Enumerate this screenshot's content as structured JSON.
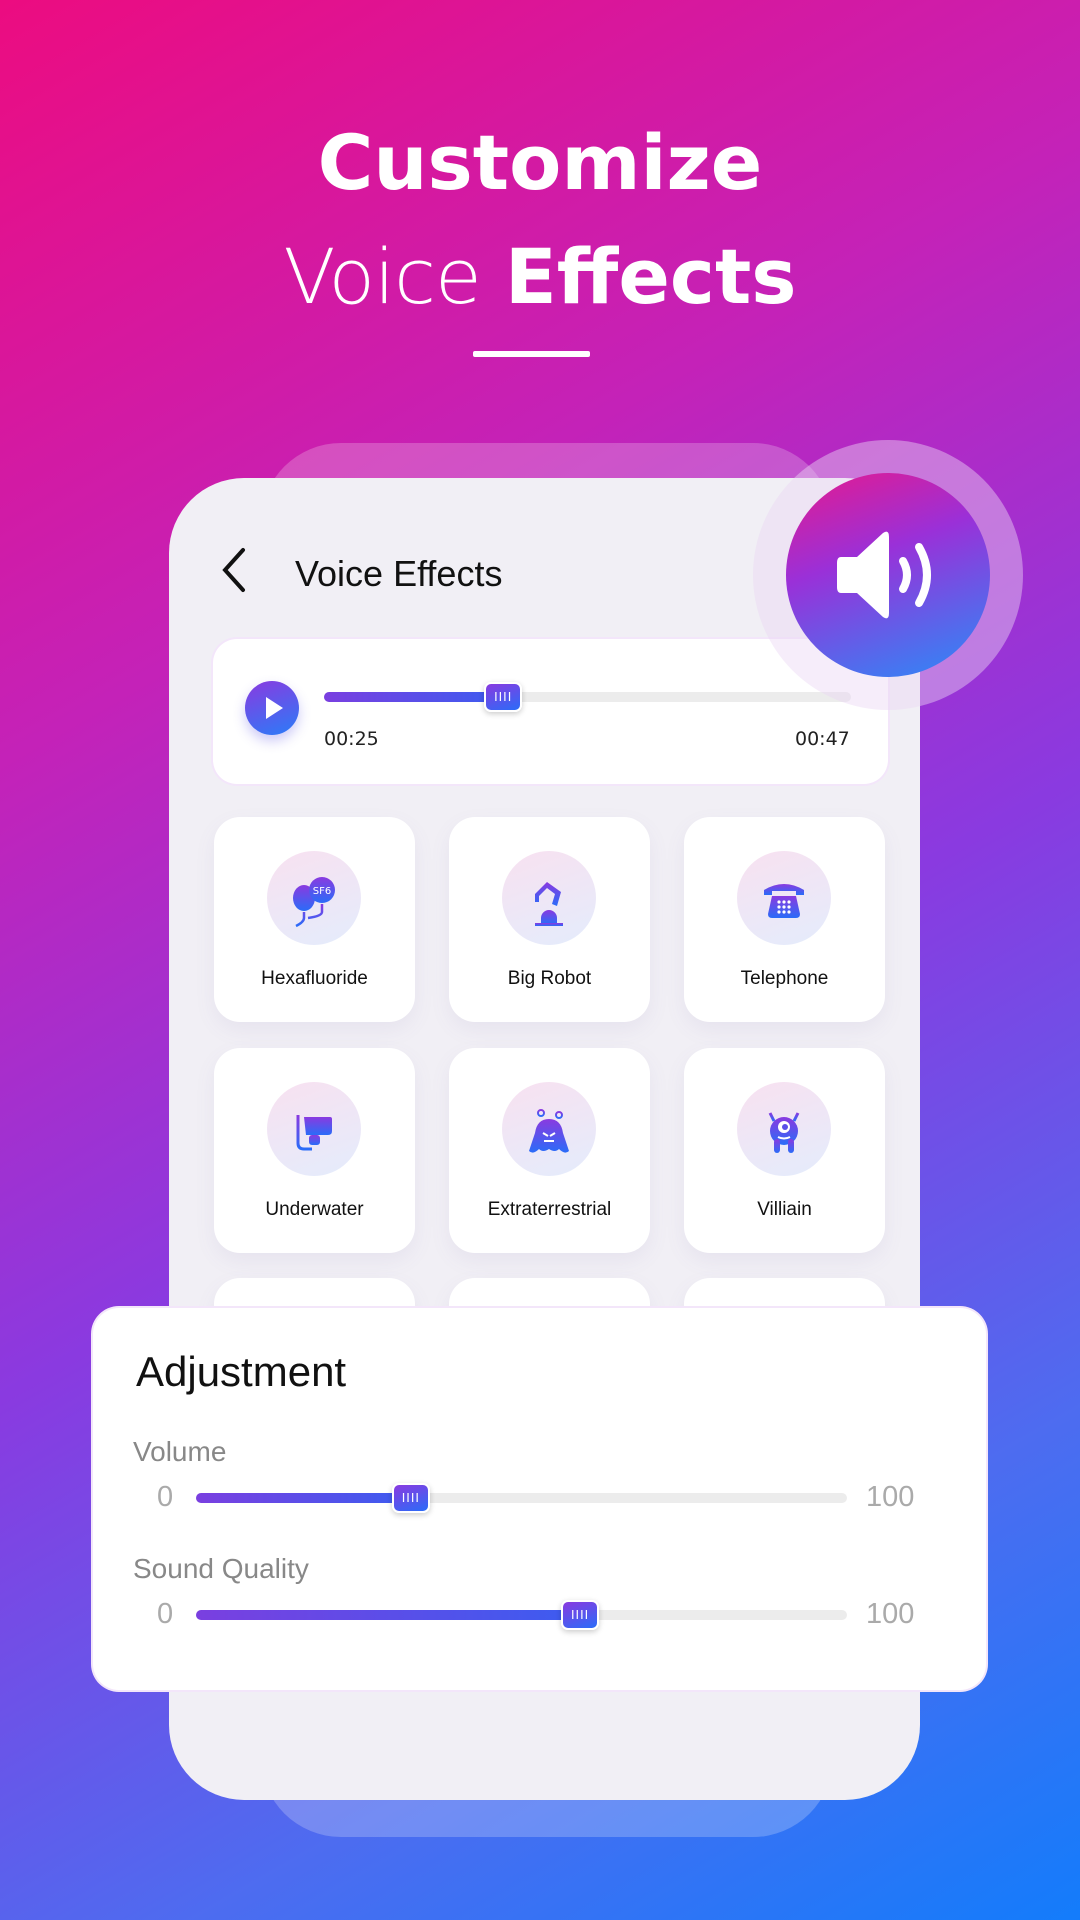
{
  "hero": {
    "line1": "Customize",
    "line2_light": "Voice",
    "line2_bold": "Effects"
  },
  "screen": {
    "title": "Voice Effects",
    "back_icon": "chevron-left-icon",
    "speaker_icon": "speaker-volume-icon"
  },
  "player": {
    "current_time": "00:25",
    "total_time": "00:47",
    "progress_percent": 34,
    "knob_grip": "IIII"
  },
  "effects": [
    {
      "label": "Hexafluoride",
      "icon": "balloons-sf6-icon",
      "badge": "SF6"
    },
    {
      "label": "Big Robot",
      "icon": "robot-arm-icon"
    },
    {
      "label": "Telephone",
      "icon": "telephone-icon"
    },
    {
      "label": "Underwater",
      "icon": "snorkel-mask-icon"
    },
    {
      "label": "Extraterrestrial",
      "icon": "alien-icon"
    },
    {
      "label": "Villiain",
      "icon": "monster-icon"
    }
  ],
  "adjustment": {
    "title": "Adjustment",
    "volume": {
      "label": "Volume",
      "min": "0",
      "max": "100",
      "value": 33
    },
    "quality": {
      "label": "Sound Quality",
      "min": "0",
      "max": "100",
      "value": 59
    }
  },
  "colors": {
    "accent_start": "#8a3ae0",
    "accent_end": "#2a7cf8",
    "bg_pink": "#ec0c80",
    "bg_blue": "#137cfb"
  }
}
